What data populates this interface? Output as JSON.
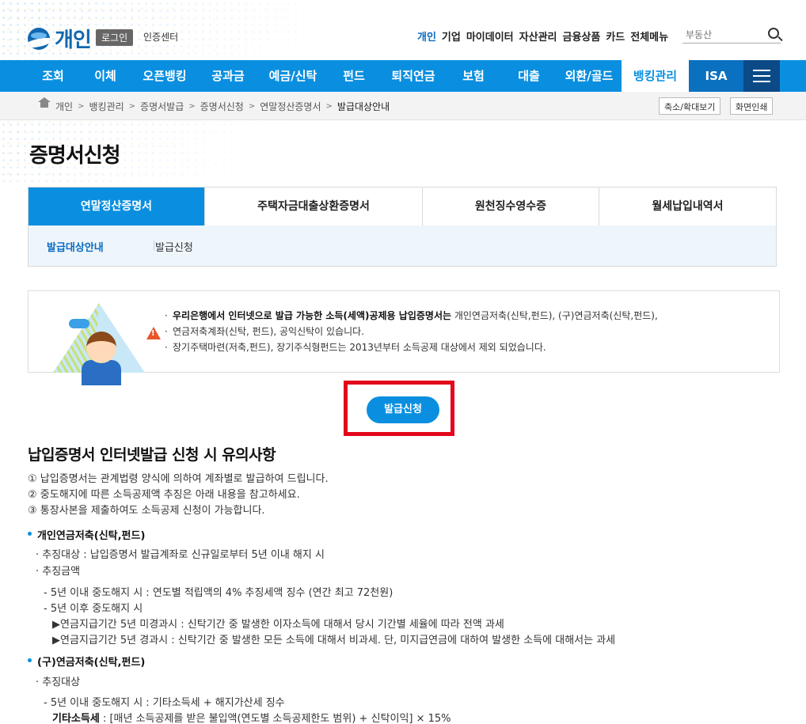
{
  "header": {
    "logo_text": "개인",
    "login_label": "로그인",
    "cert_label": "인증센터",
    "gnb": [
      "개인",
      "기업",
      "마이데이터",
      "자산관리",
      "금융상품",
      "카드",
      "전체메뉴"
    ],
    "search_placeholder": "부동산"
  },
  "nav": {
    "items": [
      "조회",
      "이체",
      "오픈뱅킹",
      "공과금",
      "예금/신탁",
      "펀드",
      "퇴직연금",
      "보험",
      "대출",
      "외환/골드",
      "뱅킹관리",
      "ISA"
    ],
    "active_index": 10
  },
  "breadcrumb": {
    "items": [
      "개인",
      "뱅킹관리",
      "증명서발급",
      "증명서신청",
      "연말정산증명서",
      "발급대상안내"
    ],
    "zoom_label": "축소/확대보기",
    "print_label": "화면인쇄"
  },
  "page_title": "증명서신청",
  "tabs": [
    "연말정산증명서",
    "주택자금대출상환증명서",
    "원천징수영수증",
    "월세납입내역서"
  ],
  "subtabs": [
    "발급대상안내",
    "발급신청"
  ],
  "notice": {
    "line1_bold": "우리은행에서 인터넷으로 발급 가능한 소득(세액)공제용 납입증명서는",
    "line1_rest": " 개인연금저축(신탁,펀드), (구)연금저축(신탁,펀드),",
    "line2": "연금저축계좌(신탁, 펀드), 공익신탁이 있습니다.",
    "line3": "장기주택마련(저축,펀드), 장기주식형펀드는 2013년부터 소득공제 대상에서 제외 되었습니다."
  },
  "issue_button": "발급신청",
  "notes": {
    "title": "납입증명서 인터넷발급 신청 시 유의사항",
    "numbered": [
      "① 납입증명서는 관계법령 양식에 의하여 계좌별로 발급하여 드립니다.",
      "② 중도해지에 따른 소득공제액 추징은 아래 내용을 참고하세요.",
      "③ 통장사본을 제출하여도 소득공제 신청이 가능합니다."
    ],
    "sec1_title": "개인연금저축(신탁,펀드)",
    "sec1_l1": "· 추징대상 : 납입증명서 발급계좌로 신규일로부터 5년 이내 해지 시",
    "sec1_l2": "· 추징금액",
    "sec1_l3": "- 5년 이내 중도해지 시 : 연도별 적립액의 4% 추징세액 징수 (연간 최고 72천원)",
    "sec1_l4": "- 5년 이후 중도해지 시",
    "sec1_l5": "▶연금지급기간 5년 미경과시 : 신탁기간 중 발생한 이자소득에 대해서 당시 기간별 세율에 따라 전액 과세",
    "sec1_l6": "▶연금지급기간 5년 경과시 : 신탁기간 중 발생한 모든 소득에 대해서 비과세. 단, 미지급연금에 대하여 발생한 소득에 대해서는 과세",
    "sec2_title": "(구)연금저축(신탁,펀드)",
    "sec2_l1": "· 추징대상",
    "sec2_l2": "- 5년 이내 중도해지 시 : 기타소득세 + 해지가산세 징수",
    "sec2_l3_lead": "기타소득세",
    "sec2_l3_rest": " : [매년 소득공제를 받은 불입액(연도별 소득공제한도 범위) + 신탁이익] × 15%"
  },
  "colors": {
    "primary": "#0a8fe0",
    "highlight": "#e3071b"
  }
}
